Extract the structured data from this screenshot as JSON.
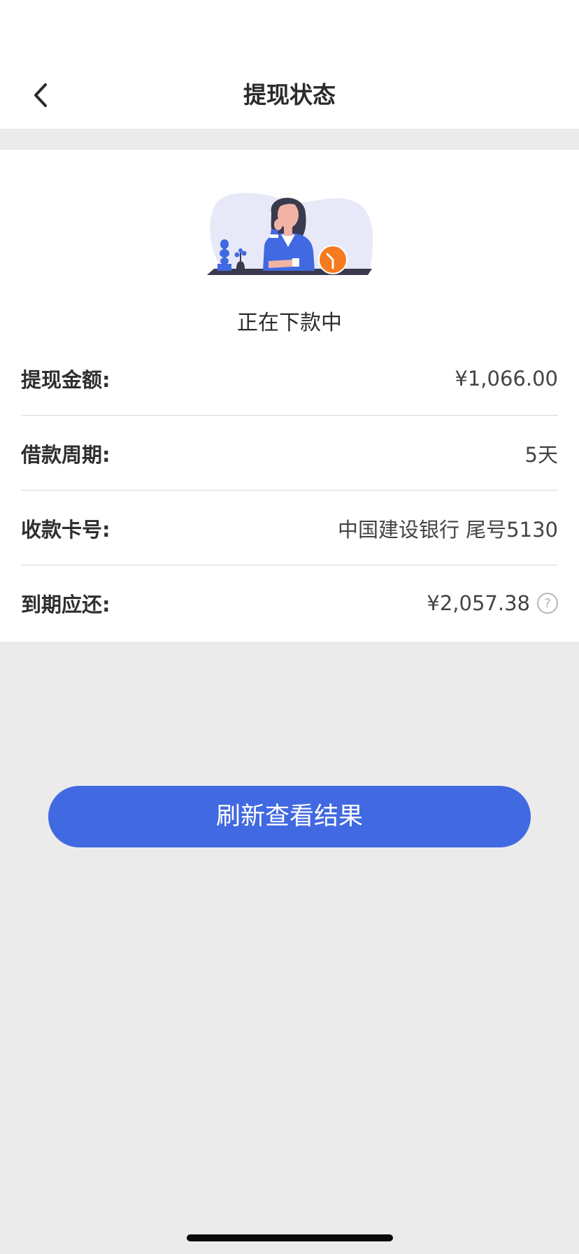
{
  "header": {
    "title": "提现状态",
    "back_icon": "chevron-left-icon"
  },
  "status": {
    "illustration": "woman-waiting-clock-illustration",
    "text": "正在下款中"
  },
  "details": [
    {
      "label": "提现金额:",
      "value": "¥1,066.00"
    },
    {
      "label": "借款周期:",
      "value": "5天"
    },
    {
      "label": "收款卡号:",
      "value": "中国建设银行 尾号5130"
    },
    {
      "label": "到期应还:",
      "value": "¥2,057.38",
      "help_icon": "question-circle-icon",
      "help_glyph": "?"
    }
  ],
  "actions": {
    "refresh_label": "刷新查看结果"
  },
  "colors": {
    "accent": "#4169e1",
    "background": "#ebebec",
    "card": "#ffffff",
    "clock_orange": "#f47b20"
  }
}
